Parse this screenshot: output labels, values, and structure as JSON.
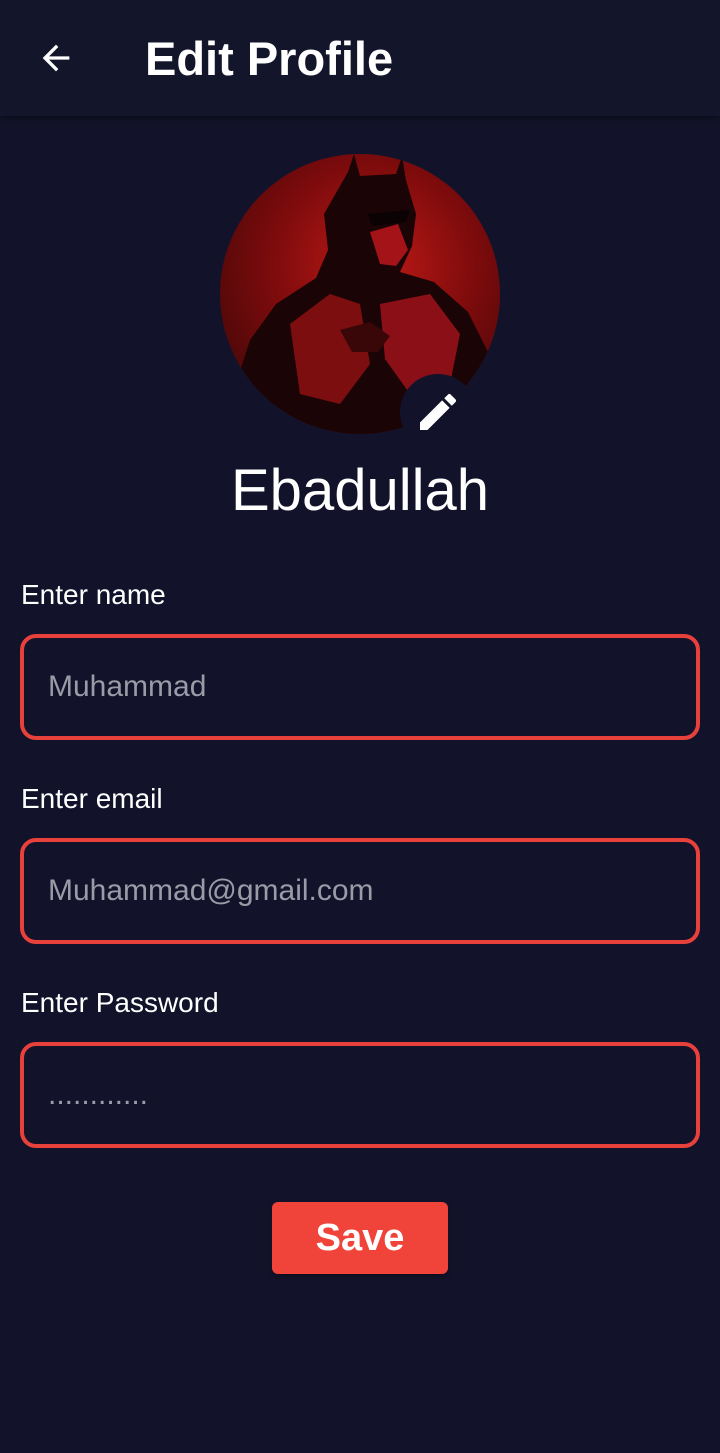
{
  "header": {
    "back_icon": "arrow-left-icon",
    "title": "Edit Profile"
  },
  "profile": {
    "name": "Ebadullah",
    "edit_icon": "pencil-icon"
  },
  "form": {
    "name": {
      "label": "Enter name",
      "placeholder": "Muhammad"
    },
    "email": {
      "label": "Enter email",
      "placeholder": "Muhammad@gmail.com"
    },
    "password": {
      "label": "Enter Password",
      "placeholder": "............"
    },
    "save_label": "Save"
  },
  "colors": {
    "background": "#12132a",
    "accent": "#f0433a",
    "field_border": "#e8403a"
  }
}
